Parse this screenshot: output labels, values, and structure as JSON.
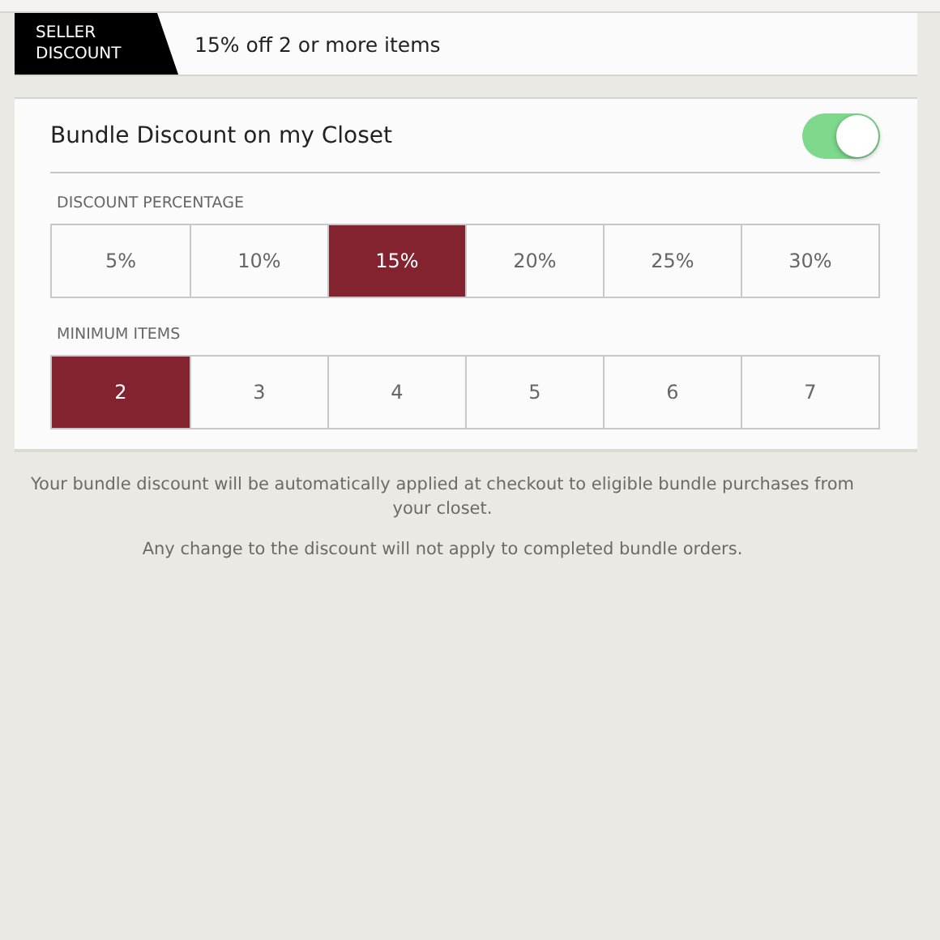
{
  "banner": {
    "tag": "SELLER DISCOUNT",
    "summary": "15% off 2 or more items"
  },
  "bundle": {
    "label": "Bundle Discount on my Closet",
    "on": true
  },
  "sections": [
    {
      "heading": "DISCOUNT PERCENTAGE",
      "options": [
        {
          "label": "5%",
          "selected": false
        },
        {
          "label": "10%",
          "selected": false
        },
        {
          "label": "15%",
          "selected": true
        },
        {
          "label": "20%",
          "selected": false
        },
        {
          "label": "25%",
          "selected": false
        },
        {
          "label": "30%",
          "selected": false
        }
      ]
    },
    {
      "heading": "MINIMUM ITEMS",
      "options": [
        {
          "label": "2",
          "selected": true
        },
        {
          "label": "3",
          "selected": false
        },
        {
          "label": "4",
          "selected": false
        },
        {
          "label": "5",
          "selected": false
        },
        {
          "label": "6",
          "selected": false
        },
        {
          "label": "7",
          "selected": false
        }
      ]
    }
  ],
  "notes": [
    "Your bundle discount will be automatically applied at checkout to eligible bundle purchases from your closet.",
    "Any change to the discount will not apply to completed bundle orders."
  ]
}
